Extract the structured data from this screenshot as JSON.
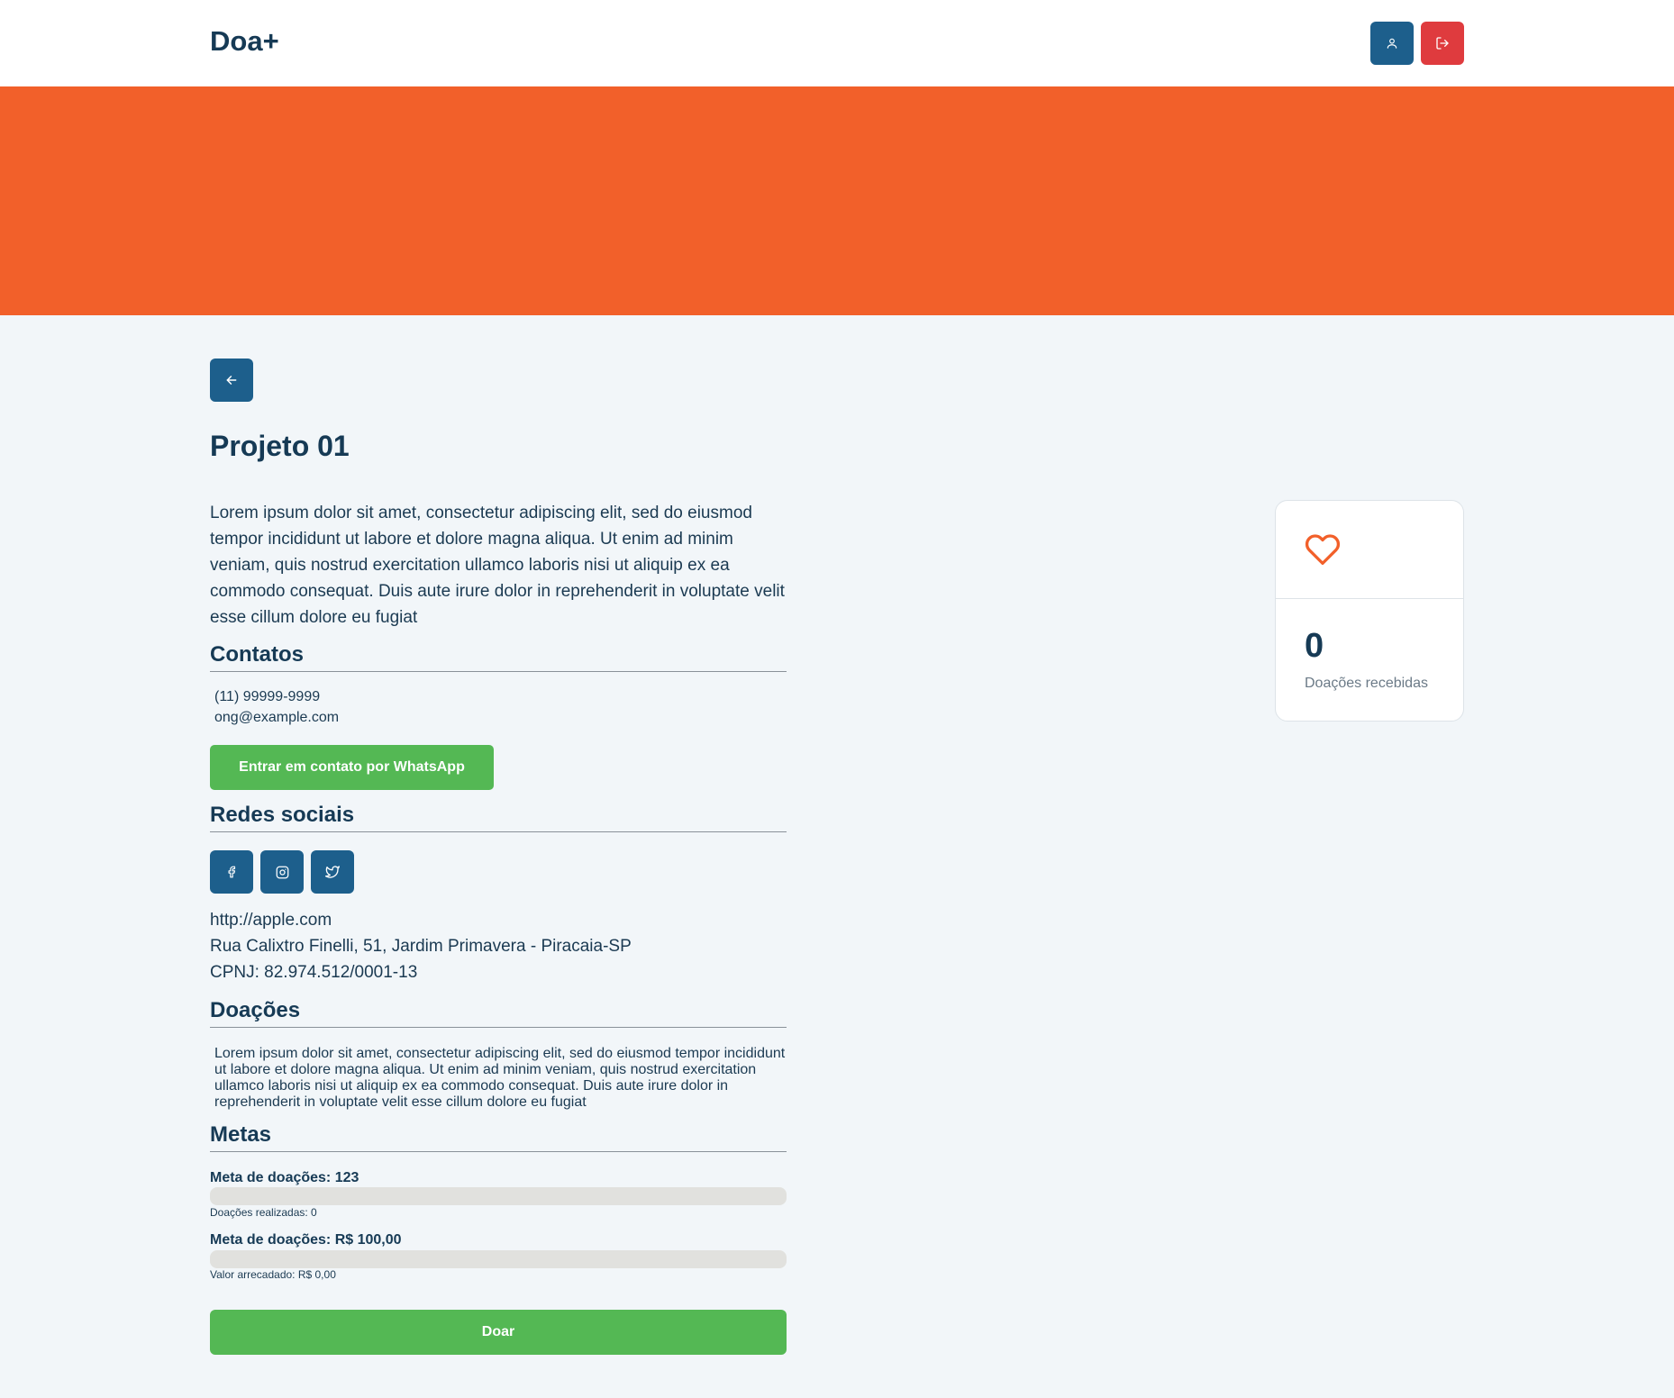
{
  "header": {
    "brand": "Doa+",
    "user_icon": "user-icon",
    "logout_icon": "logout-icon"
  },
  "colors": {
    "banner": "#f2602a",
    "primary": "#1d5f8c",
    "danger": "#df3b3e",
    "success": "#54b854",
    "heading": "#163a55"
  },
  "project": {
    "back_icon": "arrow-left-icon",
    "title": "Projeto 01",
    "description": "Lorem ipsum dolor sit amet, consectetur adipiscing elit, sed do eiusmod tempor incididunt ut labore et dolore magna aliqua. Ut enim ad minim veniam, quis nostrud exercitation ullamco laboris nisi ut aliquip ex ea commodo consequat. Duis aute irure dolor in reprehenderit in voluptate velit esse cillum dolore eu fugiat"
  },
  "contacts": {
    "heading": "Contatos",
    "phone": "(11) 99999-9999",
    "email": "ong@example.com",
    "whatsapp_label": "Entrar em contato por WhatsApp"
  },
  "social": {
    "heading": "Redes sociais",
    "icons": [
      "facebook-icon",
      "instagram-icon",
      "twitter-icon"
    ],
    "website": "http://apple.com",
    "address": "Rua Calixtro Finelli, 51, Jardim Primavera - Piracaia-SP",
    "cnpj": "CPNJ: 82.974.512/0001-13"
  },
  "donations": {
    "heading": "Doações",
    "text": "Lorem ipsum dolor sit amet, consectetur adipiscing elit, sed do eiusmod tempor incididunt ut labore et dolore magna aliqua. Ut enim ad minim veniam, quis nostrud exercitation ullamco laboris nisi ut aliquip ex ea commodo consequat. Duis aute irure dolor in reprehenderit in voluptate velit esse cillum dolore eu fugiat"
  },
  "goals": {
    "heading": "Metas",
    "items": [
      {
        "label": "Meta de doações: 123",
        "sub": "Doações realizadas: 0",
        "progress": 0
      },
      {
        "label": "Meta de doações: R$ 100,00",
        "sub": "Valor arrecadado: R$ 0,00",
        "progress": 0
      }
    ],
    "donate_label": "Doar"
  },
  "stats_card": {
    "icon": "heart-icon",
    "count": "0",
    "label": "Doações recebidas"
  }
}
